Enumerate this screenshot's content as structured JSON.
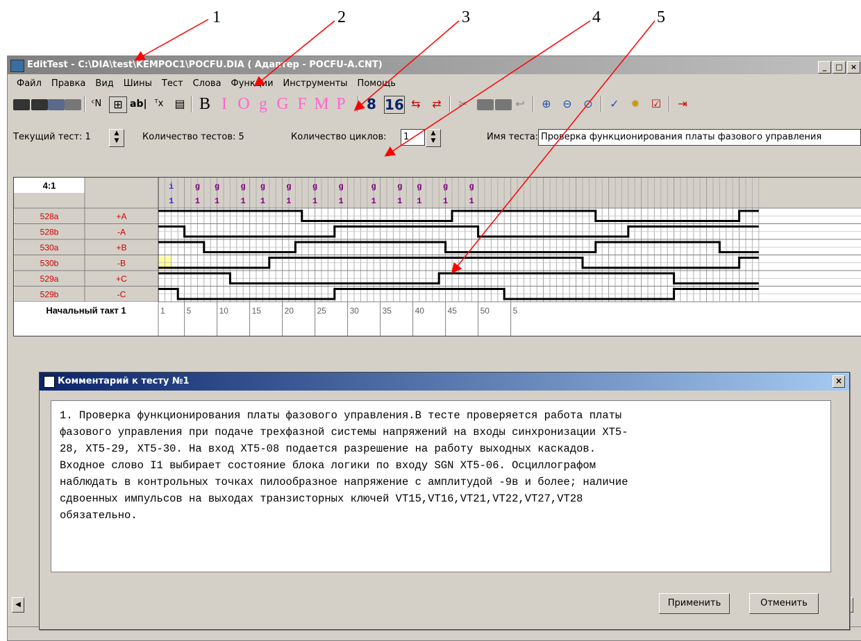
{
  "callouts": [
    "1",
    "2",
    "3",
    "4",
    "5"
  ],
  "window": {
    "title": "EditTest - C:\\DIA\\test\\KEMPOC1\\POCFU.DIA ( Адаптер - POCFU-A.CNT)",
    "controls": [
      "_",
      "□",
      "×"
    ]
  },
  "menu": [
    "Файл",
    "Правка",
    "Вид",
    "Шины",
    "Тест",
    "Слова",
    "Функции",
    "Инструменты",
    "Помощь"
  ],
  "toolbar": {
    "letters": [
      "B",
      "I",
      "O",
      "g",
      "G",
      "F",
      "M",
      "P"
    ],
    "letter_colors": [
      "#000000",
      "#ff66cc",
      "#ff66cc",
      "#ff66cc",
      "#ff66cc",
      "#ff66cc",
      "#ff66cc",
      "#ff66cc"
    ],
    "num8": "8",
    "num16": "16",
    "ab_label": "ab|"
  },
  "params": {
    "current_label": "Текущий тест: 1",
    "count_label": "Количество тестов: 5",
    "cycles_label": "Количество циклов:",
    "cycles_value": "1",
    "name_label": "Имя теста:",
    "name_value": "Проверка функционирования платы фазового управления"
  },
  "grid": {
    "corner": "4:1",
    "rows": [
      {
        "pin": "528a",
        "sig": "+A",
        "levels": [
          1,
          1,
          1,
          1,
          1,
          1,
          1,
          1,
          1,
          1,
          1,
          1,
          1,
          1,
          1,
          1,
          1,
          1,
          1,
          1,
          1,
          1,
          0,
          0,
          0,
          0,
          0,
          0,
          0,
          0,
          0,
          0,
          0,
          0,
          0,
          0,
          0,
          0,
          0,
          0,
          0,
          0,
          0,
          0,
          0,
          1,
          1,
          1,
          1,
          1,
          1,
          1,
          1,
          1,
          1,
          1,
          1,
          1,
          1,
          1,
          1,
          1,
          1,
          1,
          1,
          1,
          1,
          0,
          0,
          0,
          0,
          0,
          0,
          0,
          0,
          0,
          0,
          0,
          0,
          0,
          0,
          0,
          0,
          0,
          0,
          0,
          0,
          0,
          0,
          1,
          1,
          1
        ]
      },
      {
        "pin": "528b",
        "sig": "-A",
        "levels": [
          1,
          1,
          1,
          1,
          0,
          0,
          0,
          0,
          0,
          0,
          0,
          0,
          0,
          0,
          0,
          0,
          0,
          0,
          0,
          0,
          0,
          0,
          0,
          0,
          0,
          0,
          0,
          1,
          1,
          1,
          1,
          1,
          1,
          1,
          1,
          1,
          1,
          1,
          1,
          1,
          1,
          1,
          1,
          1,
          1,
          1,
          1,
          1,
          1,
          0,
          0,
          0,
          0,
          0,
          0,
          0,
          0,
          0,
          0,
          0,
          0,
          0,
          0,
          0,
          0,
          0,
          0,
          0,
          0,
          0,
          0,
          0,
          1,
          1,
          1,
          1,
          1,
          1,
          1,
          1,
          1,
          1,
          1,
          1,
          1,
          1,
          1,
          1,
          1,
          1,
          1,
          1
        ]
      },
      {
        "pin": "530a",
        "sig": "+B",
        "levels": [
          1,
          1,
          1,
          1,
          1,
          1,
          1,
          0,
          0,
          0,
          0,
          0,
          0,
          0,
          0,
          0,
          0,
          0,
          0,
          0,
          0,
          1,
          1,
          1,
          1,
          1,
          1,
          1,
          1,
          1,
          1,
          1,
          1,
          1,
          1,
          1,
          1,
          1,
          1,
          1,
          1,
          1,
          1,
          1,
          0,
          0,
          0,
          0,
          0,
          0,
          0,
          0,
          0,
          0,
          0,
          0,
          0,
          0,
          0,
          0,
          0,
          0,
          0,
          0,
          0,
          0,
          0,
          1,
          1,
          1,
          1,
          1,
          1,
          1,
          1,
          1,
          1,
          1,
          1,
          1,
          1,
          1,
          1,
          1,
          1,
          1,
          0,
          0,
          0,
          0,
          0,
          0
        ]
      },
      {
        "pin": "530b",
        "sig": "-B",
        "levels": [
          0,
          0,
          0,
          0,
          0,
          0,
          0,
          0,
          0,
          0,
          0,
          0,
          0,
          0,
          0,
          0,
          0,
          1,
          1,
          1,
          1,
          1,
          1,
          1,
          1,
          1,
          1,
          1,
          1,
          1,
          1,
          1,
          1,
          1,
          1,
          1,
          1,
          1,
          1,
          1,
          1,
          1,
          1,
          1,
          1,
          1,
          1,
          1,
          1,
          1,
          1,
          1,
          1,
          1,
          1,
          1,
          1,
          1,
          1,
          1,
          1,
          1,
          1,
          1,
          1,
          0,
          0,
          0,
          0,
          0,
          0,
          0,
          0,
          0,
          0,
          0,
          0,
          0,
          0,
          0,
          0,
          0,
          0,
          0,
          0,
          0,
          0,
          0,
          0,
          1,
          1,
          1
        ]
      },
      {
        "pin": "529a",
        "sig": "+C",
        "levels": [
          1,
          1,
          1,
          1,
          1,
          1,
          1,
          1,
          1,
          1,
          1,
          0,
          0,
          0,
          0,
          0,
          0,
          0,
          0,
          0,
          0,
          0,
          0,
          0,
          0,
          0,
          0,
          0,
          0,
          0,
          0,
          0,
          0,
          0,
          0,
          0,
          0,
          0,
          0,
          0,
          0,
          0,
          0,
          1,
          1,
          1,
          1,
          1,
          1,
          1,
          1,
          1,
          1,
          1,
          1,
          1,
          1,
          1,
          1,
          1,
          1,
          1,
          1,
          1,
          1,
          1,
          1,
          1,
          1,
          1,
          1,
          1,
          1,
          1,
          1,
          1,
          1,
          1,
          1,
          0,
          0,
          0,
          0,
          0,
          0,
          0,
          0,
          0,
          0,
          0,
          0,
          0
        ]
      },
      {
        "pin": "529b",
        "sig": "-C",
        "levels": [
          1,
          1,
          1,
          0,
          0,
          0,
          0,
          0,
          0,
          0,
          0,
          0,
          0,
          0,
          0,
          0,
          0,
          0,
          0,
          0,
          0,
          0,
          0,
          0,
          0,
          0,
          0,
          1,
          1,
          1,
          1,
          1,
          1,
          1,
          1,
          1,
          1,
          1,
          1,
          1,
          1,
          1,
          1,
          1,
          1,
          1,
          1,
          1,
          1,
          1,
          1,
          1,
          1,
          0,
          0,
          0,
          0,
          0,
          0,
          0,
          0,
          0,
          0,
          0,
          0,
          0,
          0,
          0,
          0,
          0,
          0,
          0,
          0,
          0,
          0,
          0,
          0,
          0,
          0,
          1,
          1,
          1,
          1,
          1,
          1,
          1,
          1,
          1,
          1,
          1,
          1,
          1
        ]
      }
    ],
    "header_marks": [
      {
        "col": 1,
        "top": "i",
        "bottom": "1",
        "color": "#3333cc"
      },
      {
        "col": 5,
        "top": "g",
        "bottom": "1",
        "color": "#800080"
      },
      {
        "col": 8,
        "top": "g",
        "bottom": "1",
        "color": "#800080"
      },
      {
        "col": 12,
        "top": "g",
        "bottom": "1",
        "color": "#800080"
      },
      {
        "col": 15,
        "top": "g",
        "bottom": "1",
        "color": "#800080"
      },
      {
        "col": 19,
        "top": "g",
        "bottom": "1",
        "color": "#800080"
      },
      {
        "col": 23,
        "top": "g",
        "bottom": "1",
        "color": "#800080"
      },
      {
        "col": 27,
        "top": "g",
        "bottom": "1",
        "color": "#800080"
      },
      {
        "col": 32,
        "top": "g",
        "bottom": "1",
        "color": "#800080"
      },
      {
        "col": 36,
        "top": "g",
        "bottom": "1",
        "color": "#800080"
      },
      {
        "col": 39,
        "top": "g",
        "bottom": "1",
        "color": "#800080"
      },
      {
        "col": 43,
        "top": "g",
        "bottom": "1",
        "color": "#800080"
      },
      {
        "col": 47,
        "top": "g",
        "bottom": "1",
        "color": "#800080"
      }
    ],
    "start_label": "Начальный такт 1",
    "tick_labels": [
      "1",
      "5",
      "10",
      "15",
      "20",
      "25",
      "30",
      "35",
      "40",
      "45",
      "50",
      "5"
    ],
    "highlight_color": "#ffff99",
    "pin_color": "#cc0000",
    "wave_color": "#000000"
  },
  "dialog": {
    "title": "Комментарий к тесту №1",
    "close": "×",
    "comment": "1. Проверка функционирования платы фазового управления.В тесте проверяется работа платы\nфазового управления при подаче трехфазной системы напряжений на входы синхронизации XT5-\n28, XT5-29, XT5-30. На вход XT5-08 подается разрешение на работу выходных каскадов.\nВходное слово I1 выбирает состояние блока логики по входу SGN XT5-06. Осциллографом\nнаблюдать в контрольных точках пилообразное напряжение с амплитудой -9в и более; наличие\nсдвоенных импульсов на выходах транзисторных ключей VT15,VT16,VT21,VT22,VT27,VT28\nобязательно.",
    "apply_label": "Применить",
    "cancel_label": "Отменить"
  },
  "colors": {
    "arrow": "#ff0000",
    "titlebar": "#808080",
    "dialog_title": "#0a246a"
  }
}
